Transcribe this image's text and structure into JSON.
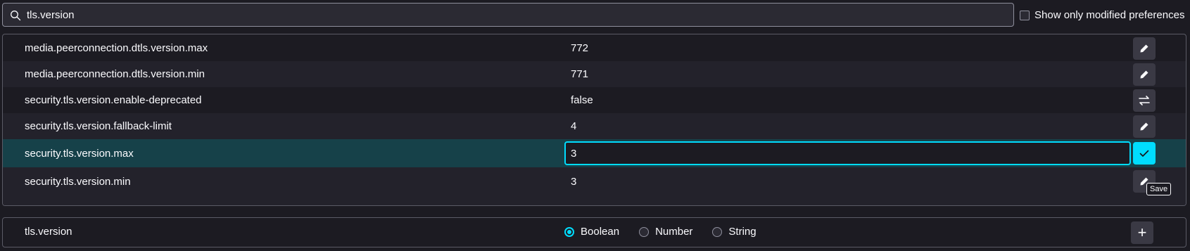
{
  "search": {
    "value": "tls.version",
    "icon": "search-icon"
  },
  "filter": {
    "label": "Show only modified preferences",
    "checked": false
  },
  "colors": {
    "accent": "#00ddff",
    "editing_row": "#164149",
    "background": "#1c1b22"
  },
  "prefs": [
    {
      "name": "media.peerconnection.dtls.version.max",
      "value": "772",
      "action": "edit-icon"
    },
    {
      "name": "media.peerconnection.dtls.version.min",
      "value": "771",
      "action": "edit-icon"
    },
    {
      "name": "security.tls.version.enable-deprecated",
      "value": "false",
      "action": "toggle-icon"
    },
    {
      "name": "security.tls.version.fallback-limit",
      "value": "4",
      "action": "edit-icon"
    },
    {
      "name": "security.tls.version.max",
      "value": "3",
      "action": "save-icon",
      "editing": true
    },
    {
      "name": "security.tls.version.min",
      "value": "3",
      "action": "edit-icon"
    }
  ],
  "tooltip": "Save",
  "new_pref": {
    "name": "tls.version",
    "types": [
      "Boolean",
      "Number",
      "String"
    ],
    "selected": "Boolean",
    "add_icon": "add-icon",
    "add_glyph": "+"
  }
}
